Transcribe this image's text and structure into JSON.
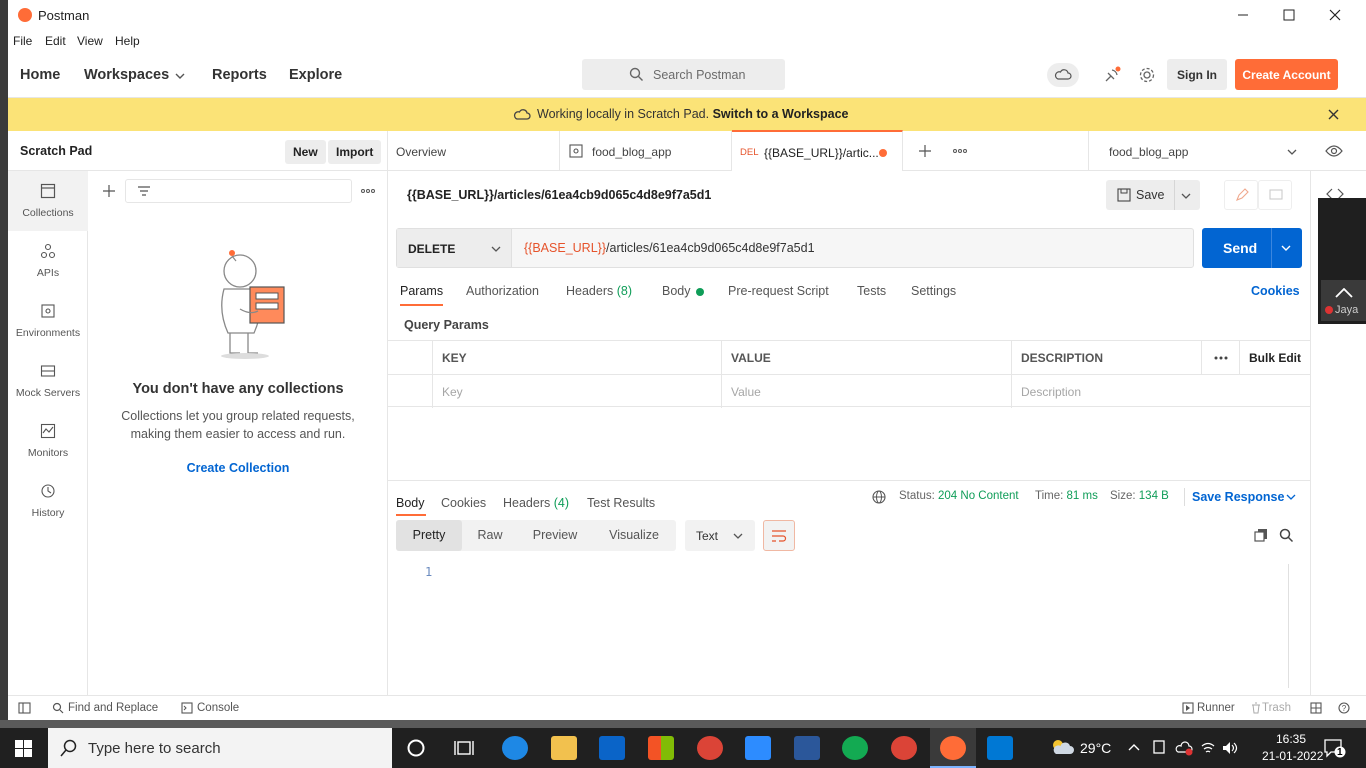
{
  "window": {
    "title": "Postman"
  },
  "menu": [
    "File",
    "Edit",
    "View",
    "Help"
  ],
  "nav": {
    "home": "Home",
    "workspaces": "Workspaces",
    "reports": "Reports",
    "explore": "Explore"
  },
  "search": {
    "placeholder": "Search Postman"
  },
  "header_buttons": {
    "sign_in": "Sign In",
    "create_account": "Create Account"
  },
  "banner": {
    "text": "Working locally in Scratch Pad.",
    "link": "Switch to a Workspace"
  },
  "sidebar": {
    "title": "Scratch Pad",
    "new_label": "New",
    "import_label": "Import",
    "rail": [
      {
        "label": "Collections",
        "icon": "collections-icon"
      },
      {
        "label": "APIs",
        "icon": "apis-icon"
      },
      {
        "label": "Environments",
        "icon": "environments-icon"
      },
      {
        "label": "Mock Servers",
        "icon": "mock-servers-icon"
      },
      {
        "label": "Monitors",
        "icon": "monitors-icon"
      },
      {
        "label": "History",
        "icon": "history-icon"
      }
    ],
    "empty": {
      "title": "You don't have any collections",
      "desc": "Collections let you group related requests, making them easier to access and run.",
      "action": "Create Collection"
    }
  },
  "tabs": {
    "overview": "Overview",
    "tab2": "food_blog_app",
    "active_method": "DEL",
    "active_title": "{{BASE_URL}}/artic...",
    "environment": "food_blog_app"
  },
  "request": {
    "name": "{{BASE_URL}}/articles/61ea4cb9d065c4d8e9f7a5d1",
    "save_label": "Save",
    "method": "DELETE",
    "url_var": "{{BASE_URL}}",
    "url_rest": "/articles/61ea4cb9d065c4d8e9f7a5d1",
    "send_label": "Send",
    "tabs": {
      "params": "Params",
      "authorization": "Authorization",
      "headers": "Headers",
      "headers_count": "(8)",
      "body": "Body",
      "prerequest": "Pre-request Script",
      "tests": "Tests",
      "settings": "Settings",
      "cookies": "Cookies"
    },
    "query_params_title": "Query Params",
    "table": {
      "headers": [
        "KEY",
        "VALUE",
        "DESCRIPTION"
      ],
      "bulk_edit": "Bulk Edit",
      "placeholders": [
        "Key",
        "Value",
        "Description"
      ]
    }
  },
  "response": {
    "tabs": {
      "body": "Body",
      "cookies": "Cookies",
      "headers": "Headers",
      "headers_count": "(4)",
      "test_results": "Test Results"
    },
    "status_label": "Status:",
    "status_value": "204 No Content",
    "time_label": "Time:",
    "time_value": "81 ms",
    "size_label": "Size:",
    "size_value": "134 B",
    "save_response": "Save Response",
    "views": [
      "Pretty",
      "Raw",
      "Preview",
      "Visualize"
    ],
    "format": "Text",
    "line_number": "1"
  },
  "statusbar": {
    "find_replace": "Find and Replace",
    "console": "Console",
    "runner": "Runner",
    "trash": "Trash"
  },
  "overlay": {
    "label": "Jaya"
  },
  "taskbar": {
    "search_placeholder": "Type here to search",
    "weather": "29°C",
    "time": "16:35",
    "date": "21-01-2022",
    "notifications": "1"
  },
  "colors": {
    "accent": "#ff6c37",
    "primary": "#0265d2",
    "banner": "#fbe377",
    "success": "#0f9d58"
  }
}
